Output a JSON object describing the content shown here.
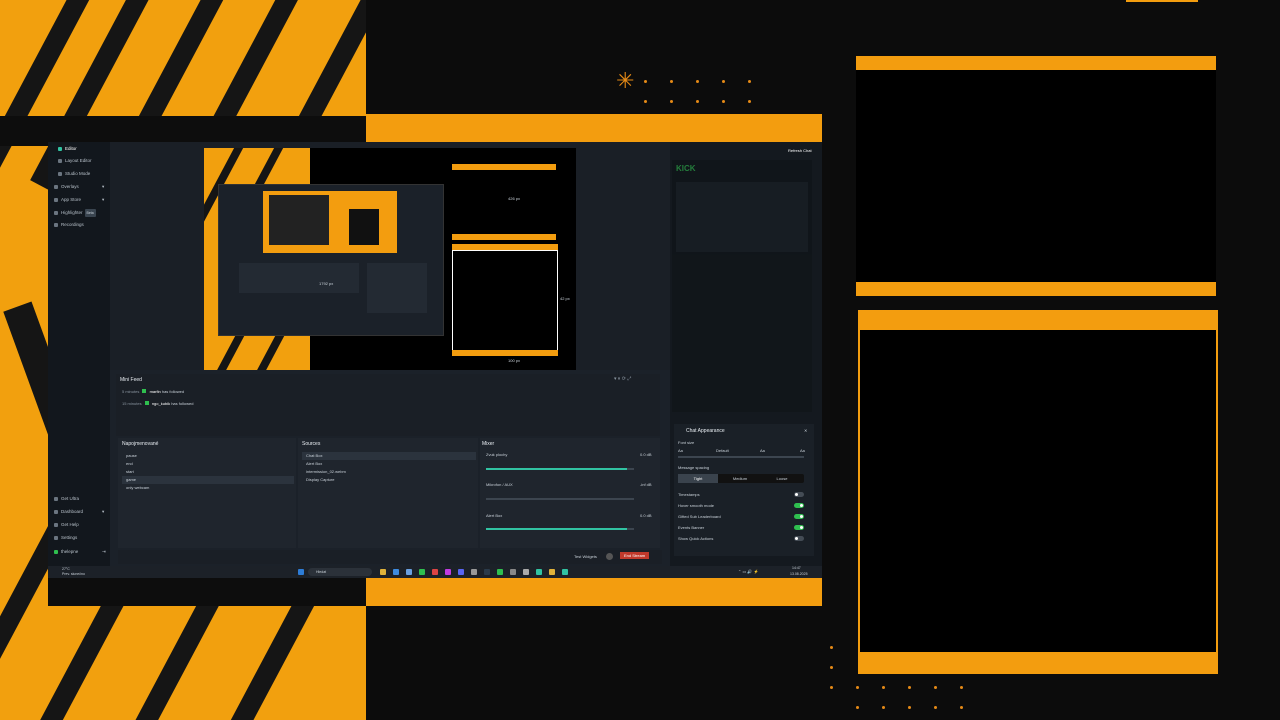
{
  "sidebar": {
    "items": [
      "Editor",
      "Layout Editor",
      "Studio Mode",
      "Overlays",
      "App Store",
      "Highlighter",
      "Recordings"
    ],
    "highlighter_badge": "Beta",
    "bottom_items": [
      "Get Ultra",
      "Dashboard",
      "Get Help",
      "Settings",
      "thelepne"
    ]
  },
  "preview": {
    "labels": [
      "426 px",
      "42 px",
      "100 px"
    ]
  },
  "minifeed": {
    "title": "Mini Feed",
    "events": [
      {
        "time": "5 minutes",
        "user": "marfin",
        "action": "has followed"
      },
      {
        "time": "15 minutes",
        "user": "ngo_kubik",
        "action": "has followed"
      }
    ]
  },
  "scenes": {
    "title": "Napojmenované",
    "items": [
      "pause",
      "end",
      "start",
      "game",
      "only webcam"
    ]
  },
  "sources": {
    "title": "Sources",
    "items": [
      "Chat Box",
      "Alert Box",
      "intermission_02.webm",
      "Display Capture"
    ]
  },
  "mixer": {
    "title": "Mixer",
    "channels": [
      {
        "name": "Zvuk plochy",
        "db": "0.0 dB",
        "level": 0.95
      },
      {
        "name": "Mikrofon / AUX",
        "db": "-inf dB",
        "level": 0.0
      },
      {
        "name": "Alert Box",
        "db": "0.0 dB",
        "level": 0.95
      }
    ]
  },
  "footer": {
    "test_widgets": "Test Widgets",
    "end_stream": "End Stream"
  },
  "chat_panel": {
    "refresh": "Refresh Chat",
    "appearance_title": "Chat Appearance",
    "font_size_label": "Font size",
    "font_size_options": [
      "Aa",
      "Default",
      "Aa",
      "Aa"
    ],
    "spacing_label": "Message spacing",
    "spacing_options": [
      "Tight",
      "Medium",
      "Loose"
    ],
    "toggles": [
      {
        "label": "Timestamps",
        "on": false
      },
      {
        "label": "Hover smooth mode",
        "on": true
      },
      {
        "label": "Gifted Sub Leaderboard",
        "on": true
      },
      {
        "label": "Events Banner",
        "on": true
      },
      {
        "label": "Show Quick Actions",
        "on": false
      }
    ]
  },
  "taskbar": {
    "weather": "27°C",
    "weather_desc": "Prev. slunečno",
    "search": "Hledat",
    "time": "14:47",
    "date": "13.08.2025"
  },
  "colors": {
    "accent": "#f39d0f",
    "teal": "#31c3a2",
    "green": "#2fbf4f",
    "red": "#c0392b"
  }
}
